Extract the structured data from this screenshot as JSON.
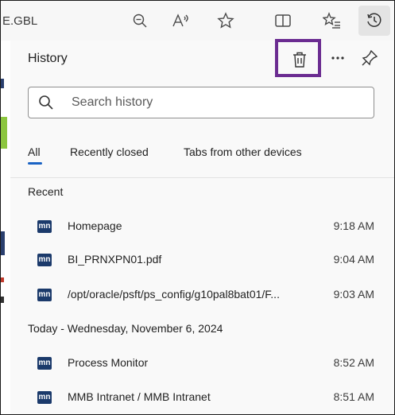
{
  "toolbar": {
    "url_fragment": "E.GBL",
    "icons": [
      "zoom-out-icon",
      "read-aloud-icon",
      "favorite-star-icon",
      "split-screen-icon",
      "favorites-list-icon",
      "history-icon"
    ]
  },
  "panel": {
    "title": "History",
    "header_icons": [
      "trash-icon",
      "more-options-icon",
      "pin-icon"
    ],
    "highlight_color": "#6b2c91"
  },
  "search": {
    "placeholder": "Search history",
    "value": ""
  },
  "tabs": [
    {
      "label": "All",
      "active": true
    },
    {
      "label": "Recently closed",
      "active": false
    },
    {
      "label": "Tabs from other devices",
      "active": false
    }
  ],
  "sections": [
    {
      "label": "Recent",
      "items": [
        {
          "favicon": "mn",
          "title": "Homepage",
          "time": "9:18 AM"
        },
        {
          "favicon": "mn",
          "title": "BI_PRNXPN01.pdf",
          "time": "9:04 AM"
        },
        {
          "favicon": "mn",
          "title": "/opt/oracle/psft/ps_config/g10pal8bat01/F...",
          "time": "9:03 AM"
        }
      ]
    },
    {
      "label": "Today - Wednesday, November 6, 2024",
      "items": [
        {
          "favicon": "mn",
          "title": "Process Monitor",
          "time": "8:52 AM"
        },
        {
          "favicon": "mn",
          "title": "MMB Intranet / MMB Intranet",
          "time": "8:51 AM"
        }
      ]
    }
  ],
  "colors": {
    "accent_underline": "#1a63c4",
    "favicon_bg": "#1b3a6b",
    "panel_bg": "#f9f9f9"
  }
}
